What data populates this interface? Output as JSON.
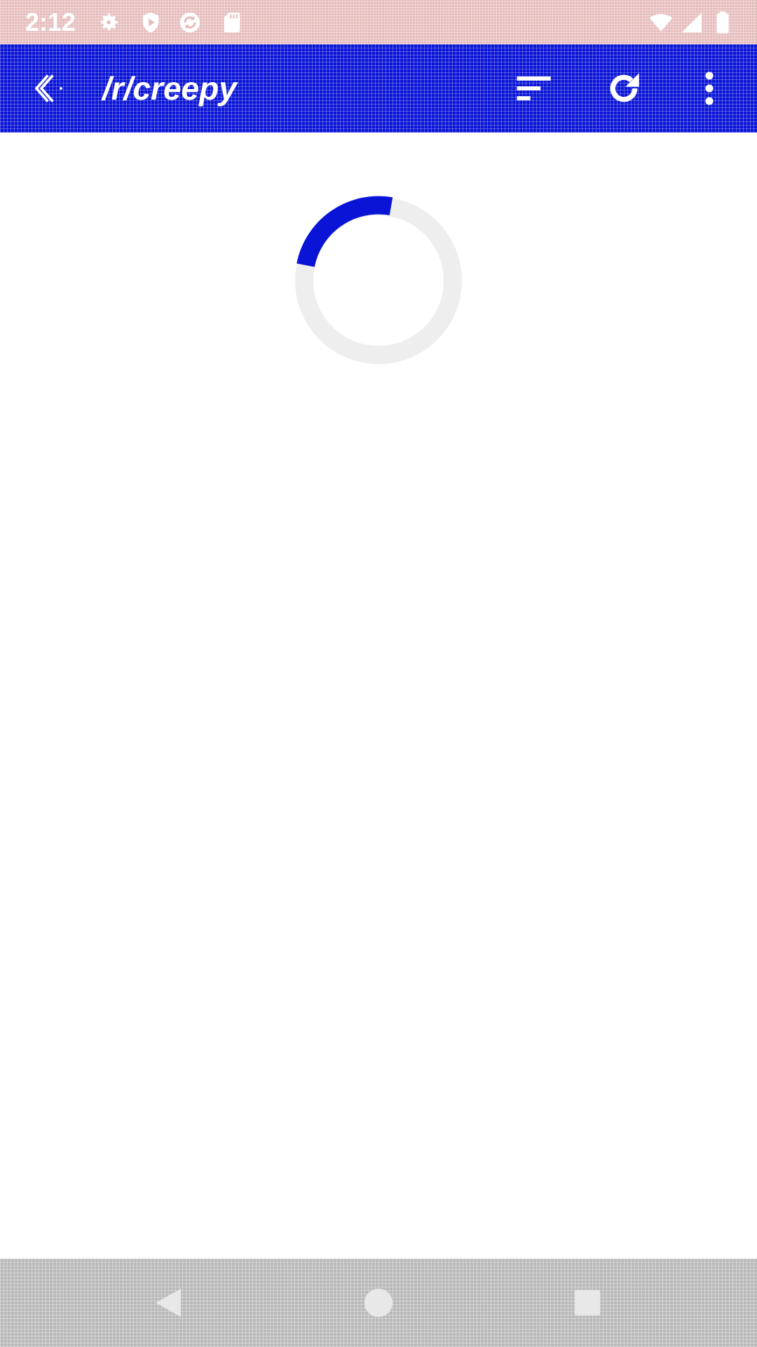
{
  "status_bar": {
    "time": "2:12",
    "left_icons": [
      "settings-gear-icon",
      "shield-play-icon",
      "sync-icon",
      "sd-card-icon"
    ],
    "right_icons": [
      "wifi-icon",
      "cell-signal-icon",
      "battery-icon"
    ]
  },
  "app_bar": {
    "title": "/r/creepy",
    "background_color": "#0a14d6",
    "icons": [
      "back-arrow-icon",
      "sort-icon",
      "refresh-icon",
      "overflow-menu-icon"
    ]
  },
  "content": {
    "loading": true,
    "spinner_color": "#0a14d6",
    "spinner_track_color": "#eeeeee"
  },
  "nav_bar": {
    "icons": [
      "nav-back-icon",
      "nav-home-icon",
      "nav-recents-icon"
    ]
  }
}
